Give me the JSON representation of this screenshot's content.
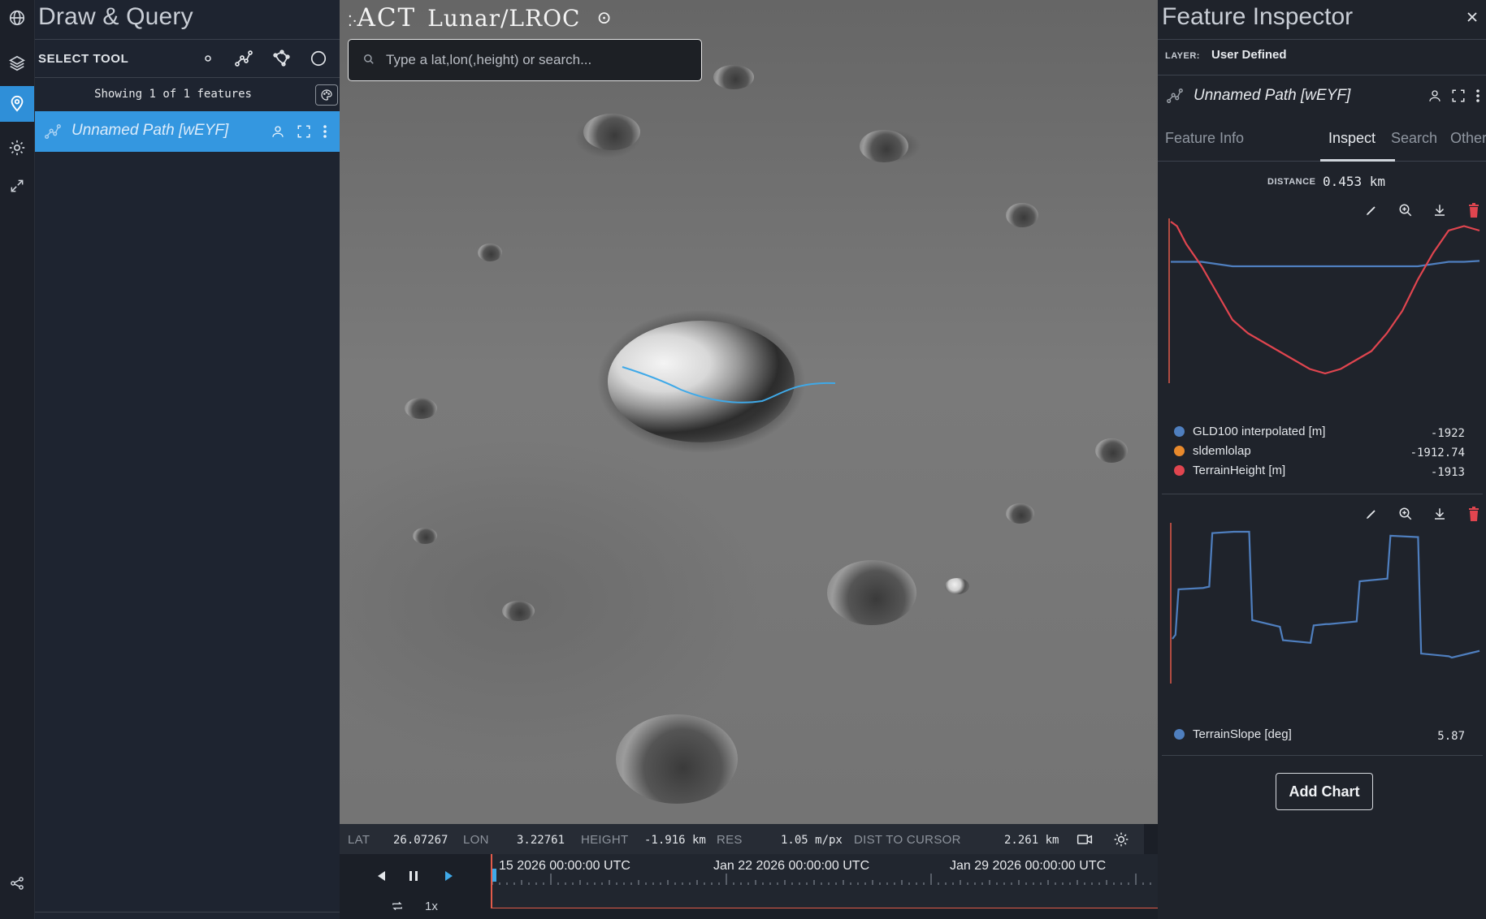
{
  "draw_panel": {
    "title": "Draw & Query",
    "tool_label": "SELECT TOOL",
    "feature_count": "Showing 1 of 1 features",
    "features": [
      {
        "name": "Unnamed Path [wEYF]"
      }
    ]
  },
  "map": {
    "brand": "ACT",
    "body": "Lunar/LROC",
    "search_placeholder": "Type a lat,lon(,height) or search..."
  },
  "status_bar": {
    "lat_label": "LAT",
    "lat": "26.07267",
    "lon_label": "LON",
    "lon": "3.22761",
    "height_label": "HEIGHT",
    "height": "-1.916 km",
    "res_label": "RES",
    "res": "1.05 m/px",
    "dist_label": "DIST TO CURSOR",
    "dist": "2.261 km"
  },
  "timeline": {
    "labels": [
      "15 2026 00:00:00 UTC",
      "Jan 22 2026 00:00:00 UTC",
      "Jan 29 2026 00:00:00 UTC"
    ],
    "speed": "1x"
  },
  "inspector": {
    "title": "Feature Inspector",
    "layer_label": "LAYER:",
    "layer_value": "User Defined",
    "feature_name": "Unnamed Path [wEYF]",
    "tabs": [
      "Feature Info",
      "Inspect",
      "Search",
      "Other"
    ],
    "active_tab": "Inspect",
    "distance_label": "DISTANCE",
    "distance_value": "0.453 km",
    "chart1_legend": [
      {
        "name": "GLD100 interpolated [m]",
        "value": "-1922",
        "color": "#4f7fbf"
      },
      {
        "name": "sldemlolap",
        "value": "-1912.74",
        "color": "#e8892c"
      },
      {
        "name": "TerrainHeight [m]",
        "value": "-1913",
        "color": "#e0454f"
      }
    ],
    "chart2_legend": [
      {
        "name": "TerrainSlope [deg]",
        "value": "5.87",
        "color": "#4f7fbf"
      }
    ],
    "add_chart_label": "Add Chart"
  },
  "chart_data": [
    {
      "type": "line",
      "title": "",
      "x": [
        0,
        0.02,
        0.05,
        0.1,
        0.15,
        0.2,
        0.25,
        0.3,
        0.35,
        0.4,
        0.45,
        0.5,
        0.55,
        0.6,
        0.65,
        0.7,
        0.75,
        0.8,
        0.85,
        0.9,
        0.95,
        1.0
      ],
      "series": [
        {
          "name": "GLD100 interpolated [m]",
          "color": "#4f7fbf",
          "values": [
            -1922,
            -1922,
            -1922,
            -1922,
            -1922.5,
            -1923,
            -1923,
            -1923,
            -1923,
            -1923,
            -1923,
            -1923,
            -1923,
            -1923,
            -1923,
            -1923,
            -1923,
            -1923,
            -1922.5,
            -1922,
            -1922,
            -1921.8
          ]
        },
        {
          "name": "TerrainHeight [m]",
          "color": "#e0454f",
          "values": [
            -1913,
            -1914,
            -1918,
            -1923,
            -1929,
            -1935,
            -1938,
            -1940,
            -1942,
            -1944,
            -1946,
            -1947,
            -1946,
            -1944,
            -1942,
            -1938,
            -1933,
            -1926,
            -1920,
            -1915,
            -1914,
            -1915
          ]
        }
      ],
      "xlabel": "",
      "ylabel": ""
    },
    {
      "type": "line",
      "title": "",
      "x": [
        0,
        0.01,
        0.02,
        0.1,
        0.12,
        0.13,
        0.2,
        0.25,
        0.26,
        0.35,
        0.36,
        0.45,
        0.46,
        0.5,
        0.51,
        0.6,
        0.61,
        0.7,
        0.71,
        0.8,
        0.81,
        0.9,
        0.91,
        1.0
      ],
      "series": [
        {
          "name": "TerrainSlope [deg]",
          "color": "#4f7fbf",
          "values": [
            5.9,
            6.2,
            9.6,
            9.7,
            9.8,
            13.8,
            13.9,
            13.9,
            7.3,
            6.8,
            5.8,
            5.6,
            6.9,
            7.0,
            7.0,
            7.2,
            10.2,
            10.4,
            13.6,
            13.5,
            4.8,
            4.6,
            4.5,
            5.0
          ]
        }
      ],
      "xlabel": "",
      "ylabel": ""
    }
  ]
}
